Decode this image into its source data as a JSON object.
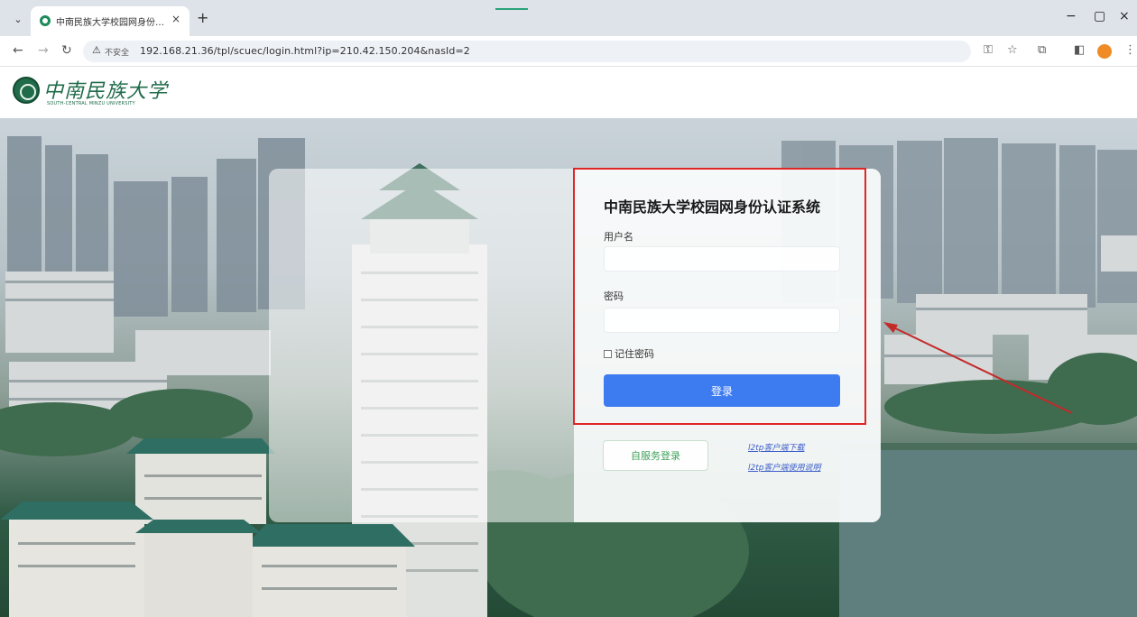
{
  "browser": {
    "tab_title": "中南民族大学校园网身份认证系统",
    "tab_close": "×",
    "new_tab": "+",
    "insecure_label": "不安全",
    "url": "192.168.21.36/tpl/scuec/login.html?ip=210.42.150.204&nasId=2",
    "window_controls": {
      "minimize": "−",
      "maximize": "▢",
      "close": "×"
    }
  },
  "site": {
    "logo_text": "中南民族大学",
    "logo_subtext": "SOUTH-CENTRAL MINZU UNIVERSITY"
  },
  "login": {
    "title": "中南民族大学校园网身份认证系统",
    "username_label": "用户名",
    "username_value": "",
    "password_label": "密码",
    "password_value": "",
    "remember_label": "记住密码",
    "remember_checked": false,
    "submit_label": "登录",
    "self_service_label": "自服务登录",
    "links": [
      "l2tp客户端下载",
      "l2tp客户端使用说明"
    ]
  },
  "colors": {
    "primary_button": "#3d7bf0",
    "annotation": "#e02626",
    "brand_green": "#1f6b4a",
    "self_service_text": "#3ea35a"
  },
  "icons": [
    "back-icon",
    "forward-icon",
    "reload-icon",
    "warning-icon",
    "key-icon",
    "star-icon",
    "extensions-icon",
    "sidebar-icon",
    "profile-icon",
    "more-icon"
  ]
}
